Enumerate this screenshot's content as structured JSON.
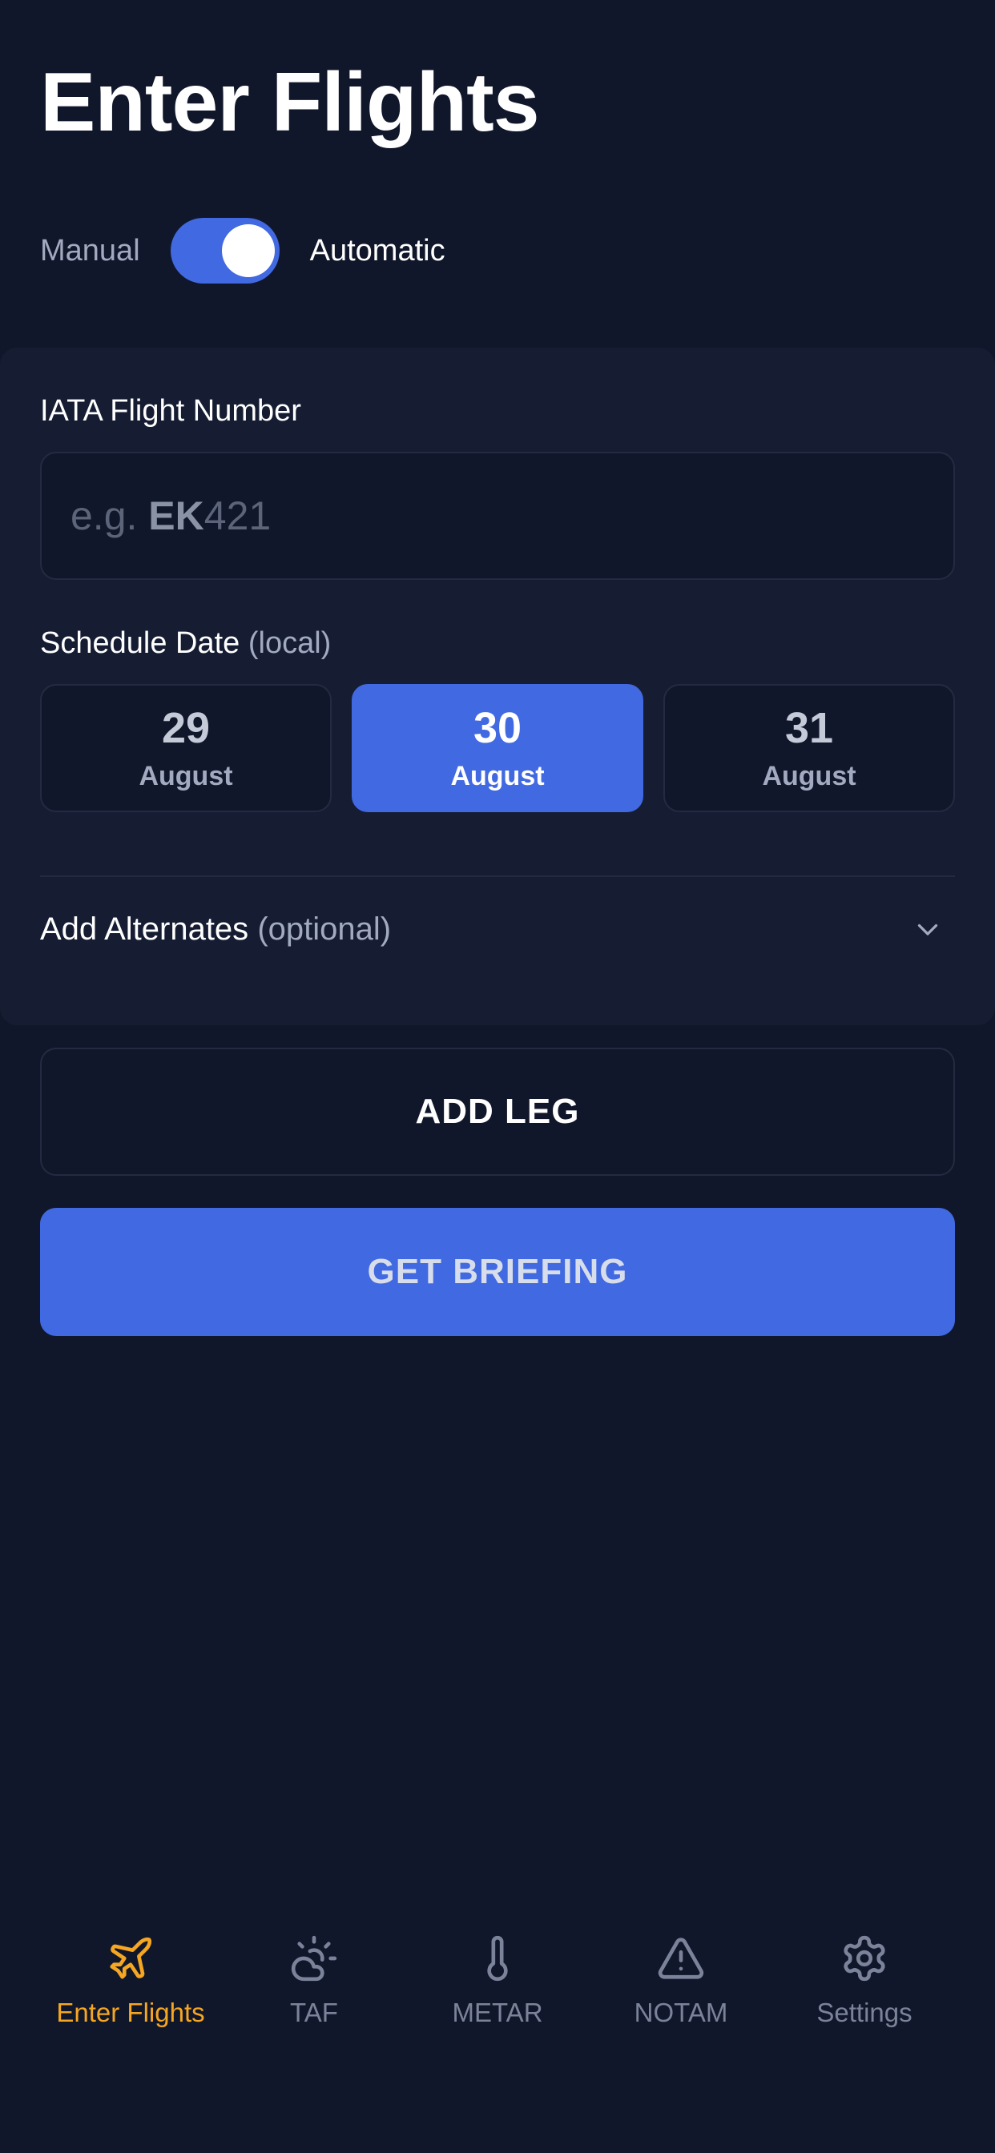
{
  "header": {
    "title": "Enter Flights"
  },
  "mode_toggle": {
    "off_label": "Manual",
    "on_label": "Automatic",
    "enabled": true
  },
  "flight_number": {
    "label": "IATA Flight Number",
    "placeholder_prefix": "e.g. ",
    "placeholder_code": "EK",
    "placeholder_number": "421",
    "value": ""
  },
  "schedule_date": {
    "label": "Schedule Date",
    "label_suffix": "(local)",
    "dates": [
      {
        "day": "29",
        "month": "August",
        "selected": false
      },
      {
        "day": "30",
        "month": "August",
        "selected": true
      },
      {
        "day": "31",
        "month": "August",
        "selected": false
      }
    ]
  },
  "alternates": {
    "label": "Add Alternates",
    "label_suffix": "(optional)",
    "icon": "chevron-down-icon"
  },
  "buttons": {
    "add_leg": "ADD LEG",
    "get_briefing": "GET BRIEFING"
  },
  "tabbar": {
    "items": [
      {
        "label": "Enter Flights",
        "icon": "airplane-icon",
        "active": true
      },
      {
        "label": "TAF",
        "icon": "sun-cloud-icon",
        "active": false
      },
      {
        "label": "METAR",
        "icon": "thermometer-icon",
        "active": false
      },
      {
        "label": "NOTAM",
        "icon": "warning-triangle-icon",
        "active": false
      },
      {
        "label": "Settings",
        "icon": "gear-icon",
        "active": false
      }
    ]
  },
  "colors": {
    "background": "#11172a",
    "card": "#161d33",
    "accent": "#4169e1",
    "active_tab": "#f5a623",
    "inactive_tab": "#7a839a"
  }
}
